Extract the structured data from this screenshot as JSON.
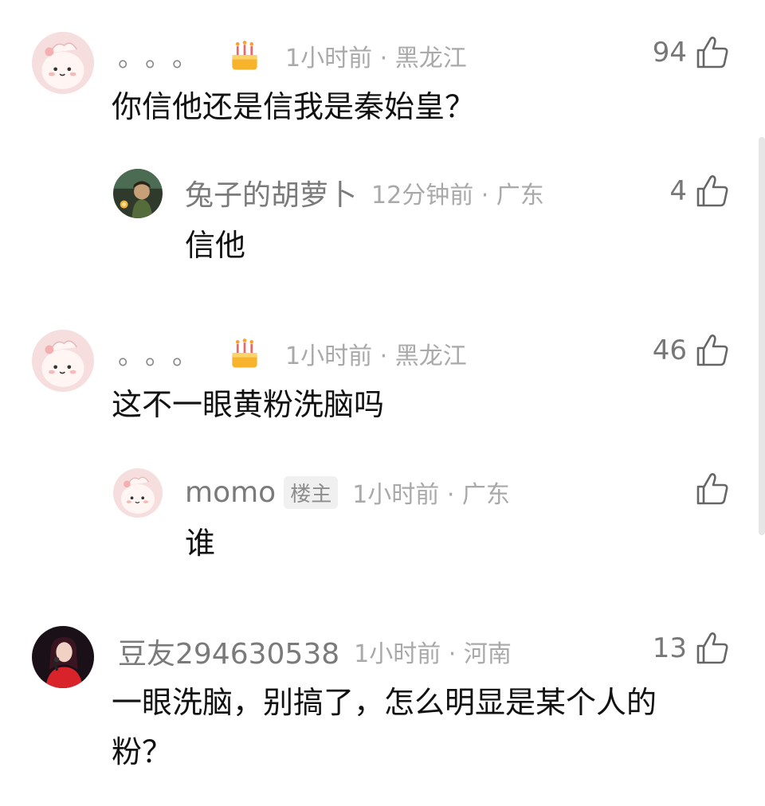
{
  "comments": [
    {
      "name": "。。。",
      "time": "1小时前 · 黑龙江",
      "likes": "94",
      "text": "你信他还是信我是秦始皇？",
      "icons": {
        "avatar": "pink-bunny-avatar",
        "badge": "birthday-cake-icon",
        "like": "thumbs-up-icon"
      }
    },
    {
      "name": "兔子的胡萝卜",
      "time": "12分钟前 · 广东",
      "likes": "4",
      "text": "信他",
      "icons": {
        "avatar": "dark-forest-avatar",
        "like": "thumbs-up-icon"
      }
    },
    {
      "name": "。。。",
      "time": "1小时前 · 黑龙江",
      "likes": "46",
      "text": "这不一眼黄粉洗脑吗",
      "icons": {
        "avatar": "pink-bunny-avatar",
        "badge": "birthday-cake-icon",
        "like": "thumbs-up-icon"
      }
    },
    {
      "name": "momo",
      "badge": "楼主",
      "time": "1小时前 · 广东",
      "likes": "",
      "text": "谁",
      "icons": {
        "avatar": "pink-bunny-avatar",
        "like": "thumbs-up-icon"
      }
    },
    {
      "name": "豆友294630538",
      "time": "1小时前 · 河南",
      "likes": "13",
      "text_line1": "一眼洗脑，别搞了，怎么明显是某个人的",
      "text_line2": "粉？",
      "icons": {
        "avatar": "singer-red-dress-avatar",
        "like": "thumbs-up-icon"
      }
    }
  ]
}
